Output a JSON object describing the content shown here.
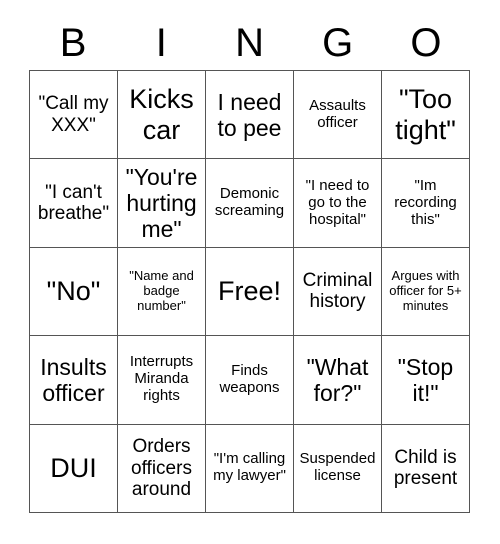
{
  "header": {
    "letters": [
      "B",
      "I",
      "N",
      "G",
      "O"
    ]
  },
  "grid": {
    "rows": 5,
    "columns": 5,
    "border_color": "#555555",
    "background_color": "#ffffff",
    "text_color": "#000000",
    "cells": [
      {
        "text": "\"Call my XXX\"",
        "size": "md"
      },
      {
        "text": "Kicks car",
        "size": "xl"
      },
      {
        "text": "I need to pee",
        "size": "lg"
      },
      {
        "text": "Assaults officer",
        "size": "sm"
      },
      {
        "text": "\"Too tight\"",
        "size": "xl"
      },
      {
        "text": "\"I can't breathe\"",
        "size": "md"
      },
      {
        "text": "\"You're hurting me\"",
        "size": "lg"
      },
      {
        "text": "Demonic screaming",
        "size": "sm"
      },
      {
        "text": "\"I need to go to the hospital\"",
        "size": "sm"
      },
      {
        "text": "\"Im recording this\"",
        "size": "sm"
      },
      {
        "text": "\"No\"",
        "size": "xl"
      },
      {
        "text": "\"Name and badge number\"",
        "size": "xs"
      },
      {
        "text": "Free!",
        "size": "xl"
      },
      {
        "text": "Criminal history",
        "size": "md"
      },
      {
        "text": "Argues with officer for 5+ minutes",
        "size": "xs"
      },
      {
        "text": "Insults officer",
        "size": "lg"
      },
      {
        "text": "Interrupts Miranda rights",
        "size": "sm"
      },
      {
        "text": "Finds weapons",
        "size": "sm"
      },
      {
        "text": "\"What for?\"",
        "size": "lg"
      },
      {
        "text": "\"Stop it!\"",
        "size": "lg"
      },
      {
        "text": "DUI",
        "size": "xl"
      },
      {
        "text": "Orders officers around",
        "size": "md"
      },
      {
        "text": "\"I'm calling my lawyer\"",
        "size": "sm"
      },
      {
        "text": "Suspended license",
        "size": "sm"
      },
      {
        "text": "Child is present",
        "size": "md"
      }
    ]
  }
}
